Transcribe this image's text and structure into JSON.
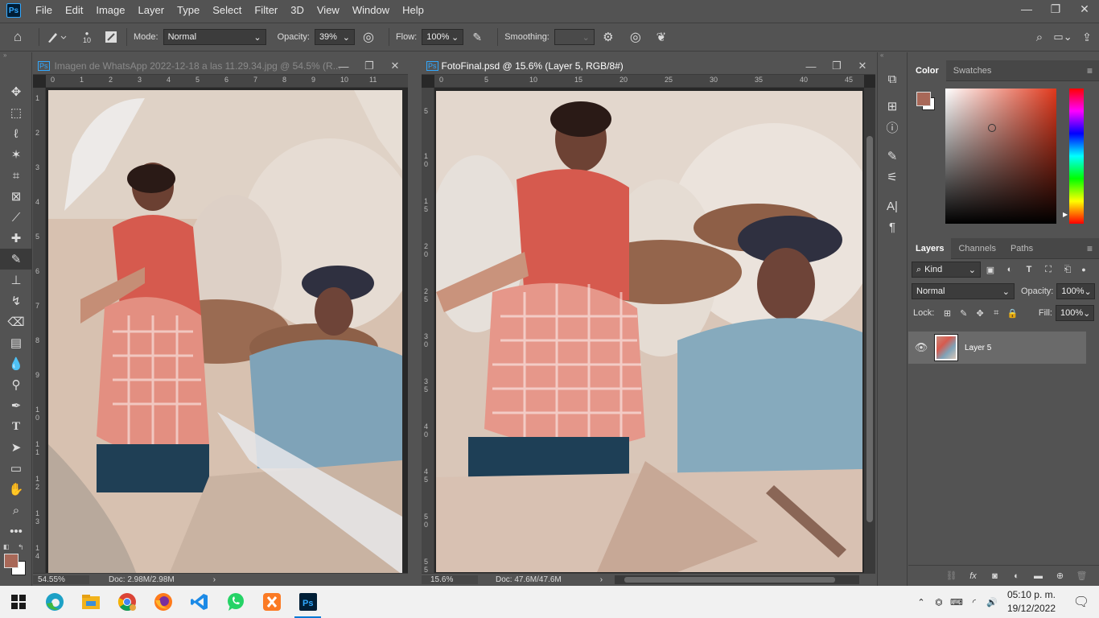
{
  "app": {
    "logo_text": "Ps"
  },
  "menu": [
    "File",
    "Edit",
    "Image",
    "Layer",
    "Type",
    "Select",
    "Filter",
    "3D",
    "View",
    "Window",
    "Help"
  ],
  "window_controls": {
    "minimize": "—",
    "restore": "❐",
    "close": "✕"
  },
  "options_bar": {
    "brush_size": "10",
    "mode_label": "Mode:",
    "mode_value": "Normal",
    "opacity_label": "Opacity:",
    "opacity_value": "39%",
    "flow_label": "Flow:",
    "flow_value": "100%",
    "smoothing_label": "Smoothing:",
    "smoothing_value": ""
  },
  "doc1": {
    "title": "Imagen de WhatsApp 2022-12-18 a las 11.29.34.jpg @ 54.5% (R...",
    "zoom": "54.55%",
    "doc_size": "Doc: 2.98M/2.98M",
    "ruler_h": [
      "0",
      "1",
      "2",
      "3",
      "4",
      "5",
      "6",
      "7",
      "8",
      "9",
      "10",
      "11"
    ],
    "ruler_v": [
      "1",
      "2",
      "3",
      "4",
      "5",
      "6",
      "7",
      "8",
      "9",
      "10",
      "11",
      "12",
      "13",
      "14"
    ]
  },
  "doc2": {
    "title": "FotoFinal.psd @ 15.6% (Layer 5, RGB/8#)",
    "zoom": "15.6%",
    "doc_size": "Doc: 47.6M/47.6M",
    "ruler_h": [
      "0",
      "5",
      "10",
      "15",
      "20",
      "25",
      "30",
      "35",
      "40",
      "45"
    ],
    "ruler_v": [
      "5",
      "10",
      "15",
      "20",
      "25",
      "30",
      "35",
      "40",
      "45",
      "50",
      "55"
    ]
  },
  "color_panel": {
    "tabs": [
      "Color",
      "Swatches"
    ],
    "foreground": "#a86858",
    "background": "#ffffff",
    "hue": "#e0381c"
  },
  "layers_panel": {
    "tabs": [
      "Layers",
      "Channels",
      "Paths"
    ],
    "filter_kind": "Kind",
    "blend_mode": "Normal",
    "opacity_label": "Opacity:",
    "opacity_value": "100%",
    "lock_label": "Lock:",
    "fill_label": "Fill:",
    "fill_value": "100%",
    "layers": [
      {
        "name": "Layer 5",
        "visible": true
      }
    ]
  },
  "taskbar": {
    "time": "05:10 p. m.",
    "date": "19/12/2022",
    "apps": [
      "start",
      "edge",
      "explorer",
      "chrome",
      "firefox",
      "vscode",
      "whatsapp",
      "xampp",
      "photoshop"
    ]
  }
}
